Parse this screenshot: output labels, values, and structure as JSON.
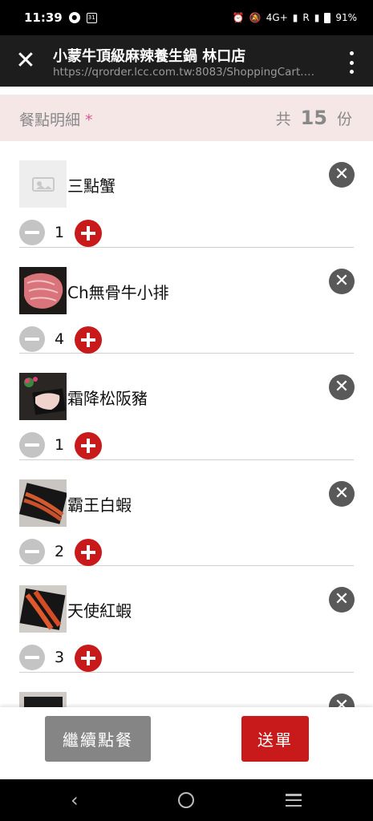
{
  "status_bar": {
    "time": "11:39",
    "battery": "91%",
    "network": "4G+",
    "signal_label": "R"
  },
  "app_bar": {
    "title": "小蒙牛頂級麻辣養生鍋 林口店",
    "url": "https://qrorder.lcc.com.tw:8083/ShoppingCart.a..."
  },
  "summary": {
    "label": "餐點明細",
    "required_mark": "*",
    "prefix": "共",
    "count": "15",
    "unit": "份"
  },
  "items": [
    {
      "name": "三點蟹",
      "qty": "1",
      "image": "placeholder-icon"
    },
    {
      "name": "Ch無骨牛小排",
      "qty": "4",
      "image": "beef-photo"
    },
    {
      "name": "霜降松阪豬",
      "qty": "1",
      "image": "pork-photo"
    },
    {
      "name": "霸王白蝦",
      "qty": "2",
      "image": "shrimp-photo"
    },
    {
      "name": "天使紅蝦",
      "qty": "3",
      "image": "red-shrimp-photo"
    }
  ],
  "footer": {
    "continue_label": "繼續點餐",
    "submit_label": "送單"
  },
  "colors": {
    "accent_red": "#c8191b",
    "summary_bg": "#f6e7e7",
    "star_pink": "#d65a98",
    "app_bar_bg": "#1d1d1d"
  }
}
